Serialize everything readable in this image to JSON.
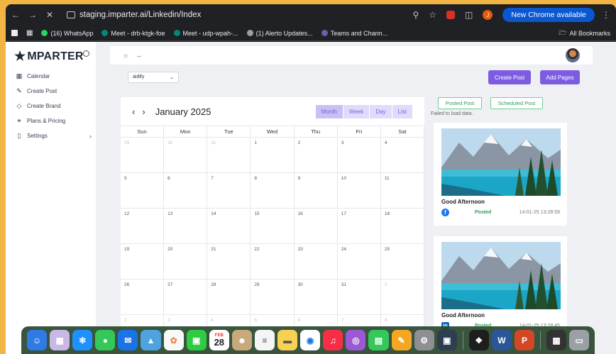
{
  "browser": {
    "url": "staging.imparter.ai/Linkedin/Index",
    "new_chrome_label": "New Chrome available",
    "profile_initial": "J",
    "bookmarks": [
      {
        "label": "(16) WhatsApp",
        "color": "#25d366"
      },
      {
        "label": "Meet - drb-ktgk-foe",
        "color": "#00897b"
      },
      {
        "label": "Meet - udp-wpah-...",
        "color": "#00897b"
      },
      {
        "label": "(1) Alerto Updates...",
        "color": "#9aa0a6"
      },
      {
        "label": "Teams and Chann...",
        "color": "#6264a7"
      }
    ],
    "all_bookmarks_label": "All Bookmarks"
  },
  "sidebar": {
    "logo": "MPARTER",
    "items": [
      {
        "label": "Calendar",
        "icon": "calendar-icon"
      },
      {
        "label": "Create Post",
        "icon": "edit-icon"
      },
      {
        "label": "Create Brand",
        "icon": "tag-icon"
      },
      {
        "label": "Plans & Pricing",
        "icon": "pricing-icon"
      },
      {
        "label": "Settings",
        "icon": "file-icon"
      }
    ]
  },
  "toolbar": {
    "brand_select": "aidify",
    "create_post_label": "Create Post",
    "add_pages_label": "Add Pages"
  },
  "calendar": {
    "title": "January 2025",
    "views": [
      "Month",
      "Week",
      "Day",
      "List"
    ],
    "active_view": "Month",
    "weekdays": [
      "Sun",
      "Mon",
      "Tue",
      "Wed",
      "Thu",
      "Fri",
      "Sat"
    ],
    "weeks": [
      [
        "29",
        "30",
        "31",
        "1",
        "2",
        "3",
        "4"
      ],
      [
        "5",
        "6",
        "7",
        "8",
        "9",
        "10",
        "11"
      ],
      [
        "12",
        "13",
        "14",
        "15",
        "16",
        "17",
        "18"
      ],
      [
        "19",
        "20",
        "21",
        "22",
        "23",
        "24",
        "25"
      ],
      [
        "26",
        "27",
        "28",
        "29",
        "30",
        "31",
        "1"
      ],
      [
        "2",
        "3",
        "4",
        "5",
        "6",
        "7",
        "8"
      ]
    ]
  },
  "posts_panel": {
    "posted_tab": "Posted Post",
    "scheduled_tab": "Scheduled Post",
    "error": "Failed to load data.",
    "posts": [
      {
        "title": "Good Afternoon",
        "platform": "facebook-icon",
        "status": "Posted",
        "timestamp": "14-01-25 13:28:59"
      },
      {
        "title": "Good Afternoon",
        "platform": "linkedin-icon",
        "status": "Posted",
        "timestamp": "14-01-25 13:28:45"
      }
    ]
  },
  "dock": {
    "calendar_month": "FEB",
    "calendar_day": "28"
  }
}
